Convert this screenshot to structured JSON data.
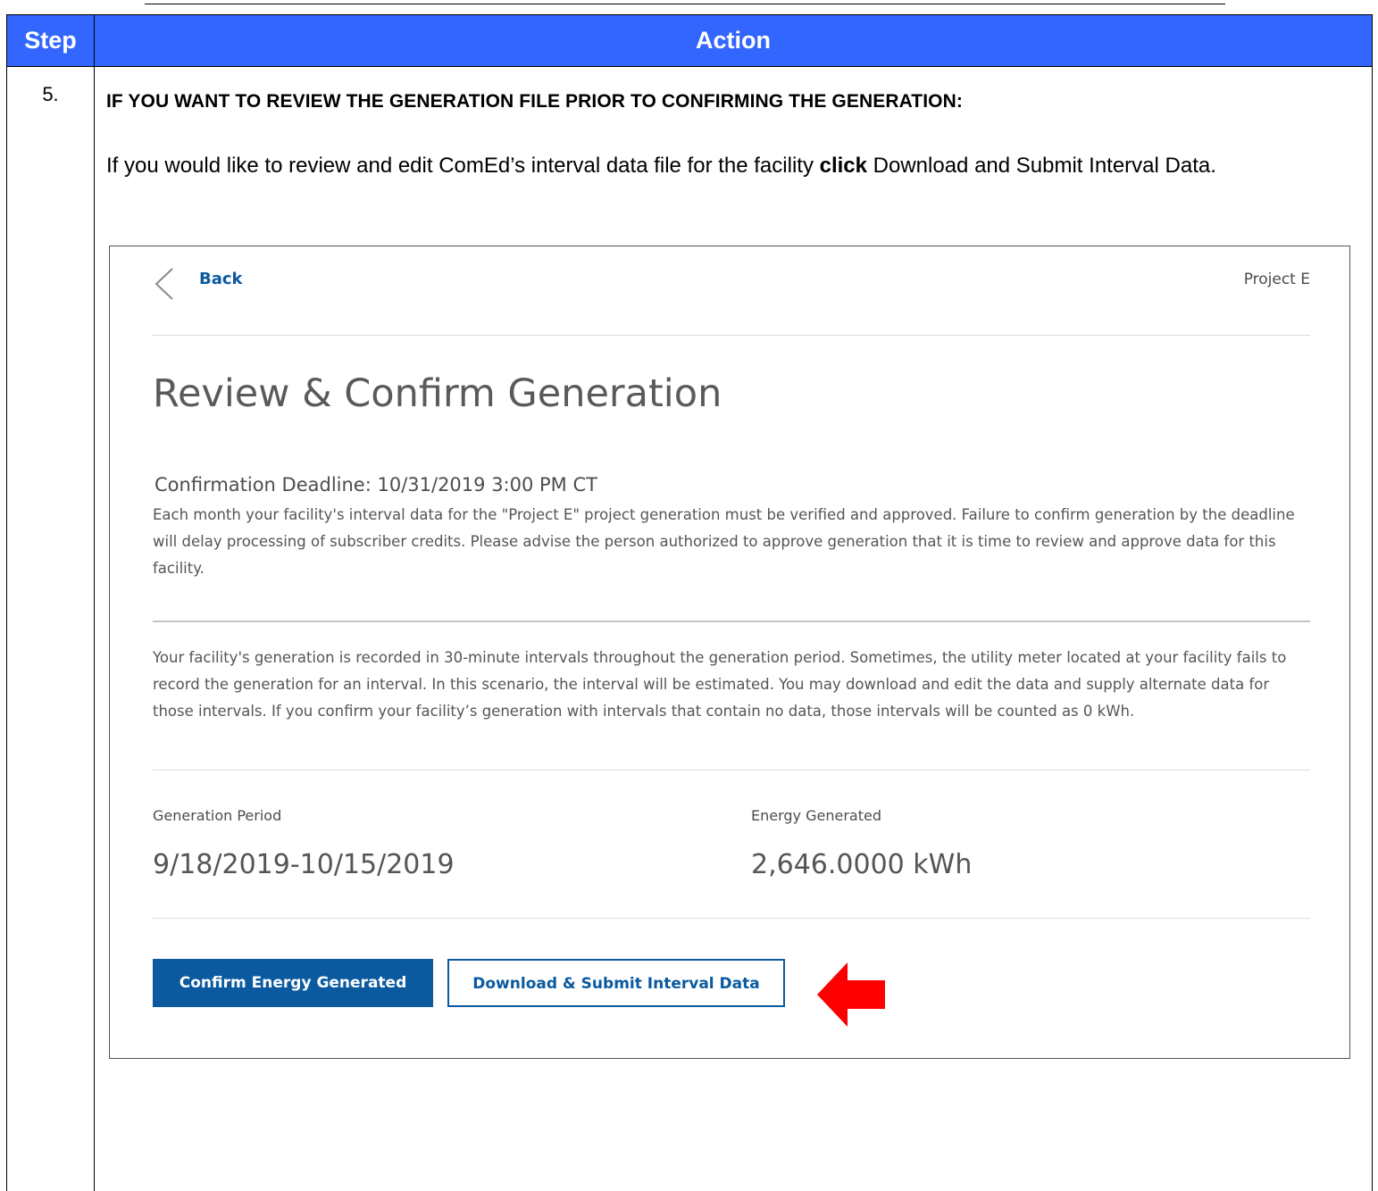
{
  "table": {
    "header_step": "Step",
    "header_action": "Action",
    "step_number": "5.",
    "heading": "IF YOU WANT TO REVIEW THE GENERATION FILE PRIOR TO CONFIRMING THE GENERATION:",
    "instruction_before": "If you would like to review and edit ComEd’s interval data file for the facility ",
    "instruction_bold": "click",
    "instruction_after": " Download and Submit Interval Data."
  },
  "screenshot": {
    "back_label": "Back",
    "project_name": "Project E",
    "title": "Review & Confirm Generation",
    "deadline": "Confirmation Deadline: 10/31/2019 3:00 PM CT",
    "paragraph_1": "Each month your facility's interval data for the \"Project E\" project generation must be verified and approved. Failure to confirm generation by the deadline will delay processing of subscriber credits. Please advise the person authorized to approve generation that it is time to review and approve data for this facility.",
    "paragraph_2": "Your facility's generation is recorded in 30-minute intervals throughout the generation period. Sometimes, the utility meter located at your facility fails to record the generation for an interval. In this scenario, the interval will be estimated. You may download and edit the data and supply alternate data for those intervals. If you confirm your facility’s generation with intervals that contain no data, those intervals will be counted as 0 kWh.",
    "generation_period_label": "Generation Period",
    "generation_period_value": "9/18/2019-10/15/2019",
    "energy_generated_label": "Energy Generated",
    "energy_generated_value": "2,646.0000 kWh",
    "confirm_button": "Confirm Energy Generated",
    "download_button": "Download & Submit Interval Data"
  },
  "colors": {
    "header_blue": "#3366ff",
    "brand_blue": "#0b5aa0",
    "arrow_red": "#ff0000"
  },
  "icons": {
    "back": "chevron-left-icon",
    "pointer": "arrow-left-icon"
  }
}
